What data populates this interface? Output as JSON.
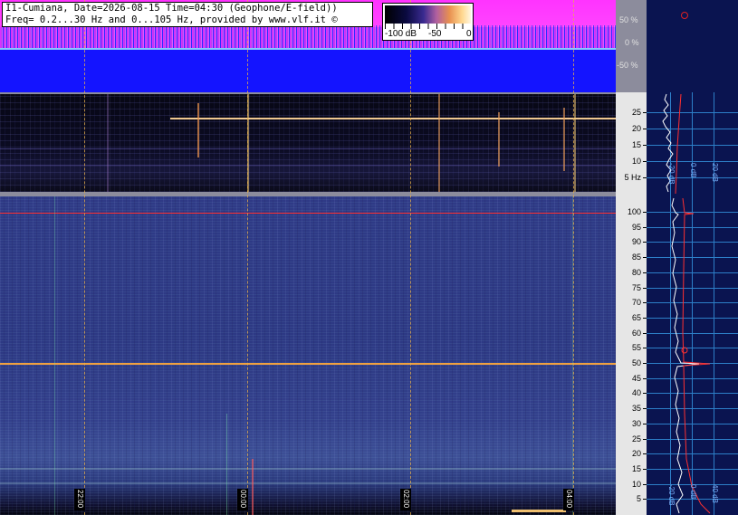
{
  "header": {
    "line1": "I1-Cumiana, Date=2026-08-15 Time=04:30 (Geophone/E-field))",
    "line2": "Freq= 0.2...30 Hz and 0...105 Hz, provided by www.vlf.it ©"
  },
  "colorbar": {
    "labels": [
      "-100 dB",
      "-50",
      "0"
    ]
  },
  "power_axis": {
    "labels": [
      "50 %",
      "0 %",
      "-50 %"
    ]
  },
  "spec1_axis": {
    "labels": [
      "25",
      "20",
      "15",
      "10",
      "5 Hz"
    ]
  },
  "spec2_axis": {
    "labels": [
      "100",
      "95",
      "90",
      "85",
      "80",
      "75",
      "70",
      "65",
      "60",
      "55",
      "50",
      "45",
      "40",
      "35",
      "30",
      "25",
      "20",
      "15",
      "10",
      "5"
    ]
  },
  "profile_db_labels": [
    "-20 dB",
    "0 dB",
    "20 dB",
    "40 dB"
  ],
  "time_labels": [
    "22:00",
    "00:00",
    "02:00",
    "04:00"
  ],
  "colors": {
    "power_fill": "#1414ff",
    "power_upper": "#ff33ff",
    "profile_bg": "#0a1450",
    "grid": "#2d7fc8",
    "marker_line": "#ff3030",
    "time_dash": "#e8b04a"
  }
}
